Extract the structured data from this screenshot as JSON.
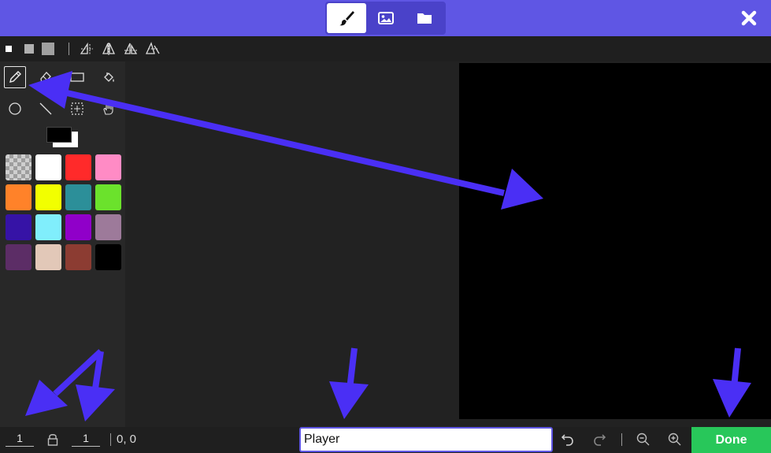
{
  "header": {
    "modes": [
      {
        "name": "paint",
        "icon": "brush-icon",
        "active": true
      },
      {
        "name": "image",
        "icon": "image-icon",
        "active": false
      },
      {
        "name": "folder",
        "icon": "folder-icon",
        "active": false
      }
    ],
    "close_icon": "close-icon",
    "accent": "#5f56e4"
  },
  "options": {
    "brush_sizes": [
      "small",
      "medium",
      "large"
    ],
    "symmetry_icons": [
      "symmetry-horizontal-icon",
      "symmetry-vertical-icon",
      "symmetry-both-icon",
      "symmetry-radial-icon"
    ]
  },
  "tools": [
    {
      "name": "pencil",
      "icon": "pencil-icon",
      "active": true
    },
    {
      "name": "eraser",
      "icon": "eraser-icon",
      "active": false
    },
    {
      "name": "rectangle",
      "icon": "rectangle-icon",
      "active": false
    },
    {
      "name": "fill",
      "icon": "paint-bucket-icon",
      "active": false
    },
    {
      "name": "circle",
      "icon": "circle-icon",
      "active": false
    },
    {
      "name": "line",
      "icon": "line-icon",
      "active": false
    },
    {
      "name": "select",
      "icon": "marquee-icon",
      "active": false
    },
    {
      "name": "pan",
      "icon": "hand-icon",
      "active": false
    }
  ],
  "palette": {
    "foreground": "#000000",
    "background": "#ffffff",
    "colors": [
      "transparent",
      "#ffffff",
      "#ff2a2a",
      "#ff8bc5",
      "#ff8229",
      "#f2ff00",
      "#2c8f99",
      "#6be22c",
      "#3613a6",
      "#80eefc",
      "#9000c9",
      "#9d7a9a",
      "#5c2d66",
      "#e2c8b8",
      "#8c3c32",
      "#000000"
    ]
  },
  "footer": {
    "width_value": "1",
    "height_value": "1",
    "lock_icon": "lock-icon",
    "coordinates": "0, 0",
    "name_value": "Player",
    "undo_icon": "undo-icon",
    "redo_icon": "redo-icon",
    "zoom_out_icon": "zoom-out-icon",
    "zoom_in_icon": "zoom-in-icon",
    "done_label": "Done",
    "done_color": "#28c75a"
  }
}
